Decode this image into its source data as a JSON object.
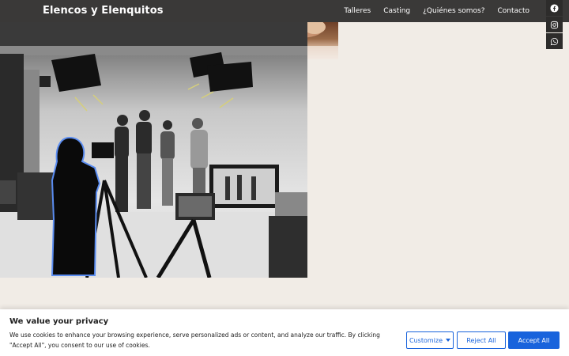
{
  "site": {
    "title": "Elencos y Elenquitos"
  },
  "nav": {
    "items": [
      "Talleres",
      "Casting",
      "¿Quiénes somos?",
      "Contacto"
    ]
  },
  "social": {
    "icons": [
      "facebook-icon",
      "instagram-icon",
      "whatsapp-icon"
    ]
  },
  "cookie": {
    "title": "We value your privacy",
    "text": "We use cookies to enhance your browsing experience, serve personalized ads or content, and analyze our traffic. By clicking \"Accept All\", you consent to our use of cookies.",
    "customize_label": "Customize",
    "reject_label": "Reject All",
    "accept_label": "Accept All"
  },
  "colors": {
    "navbar": "#3a3938",
    "page_bg": "#f1ece6",
    "accent": "#1863dc"
  }
}
